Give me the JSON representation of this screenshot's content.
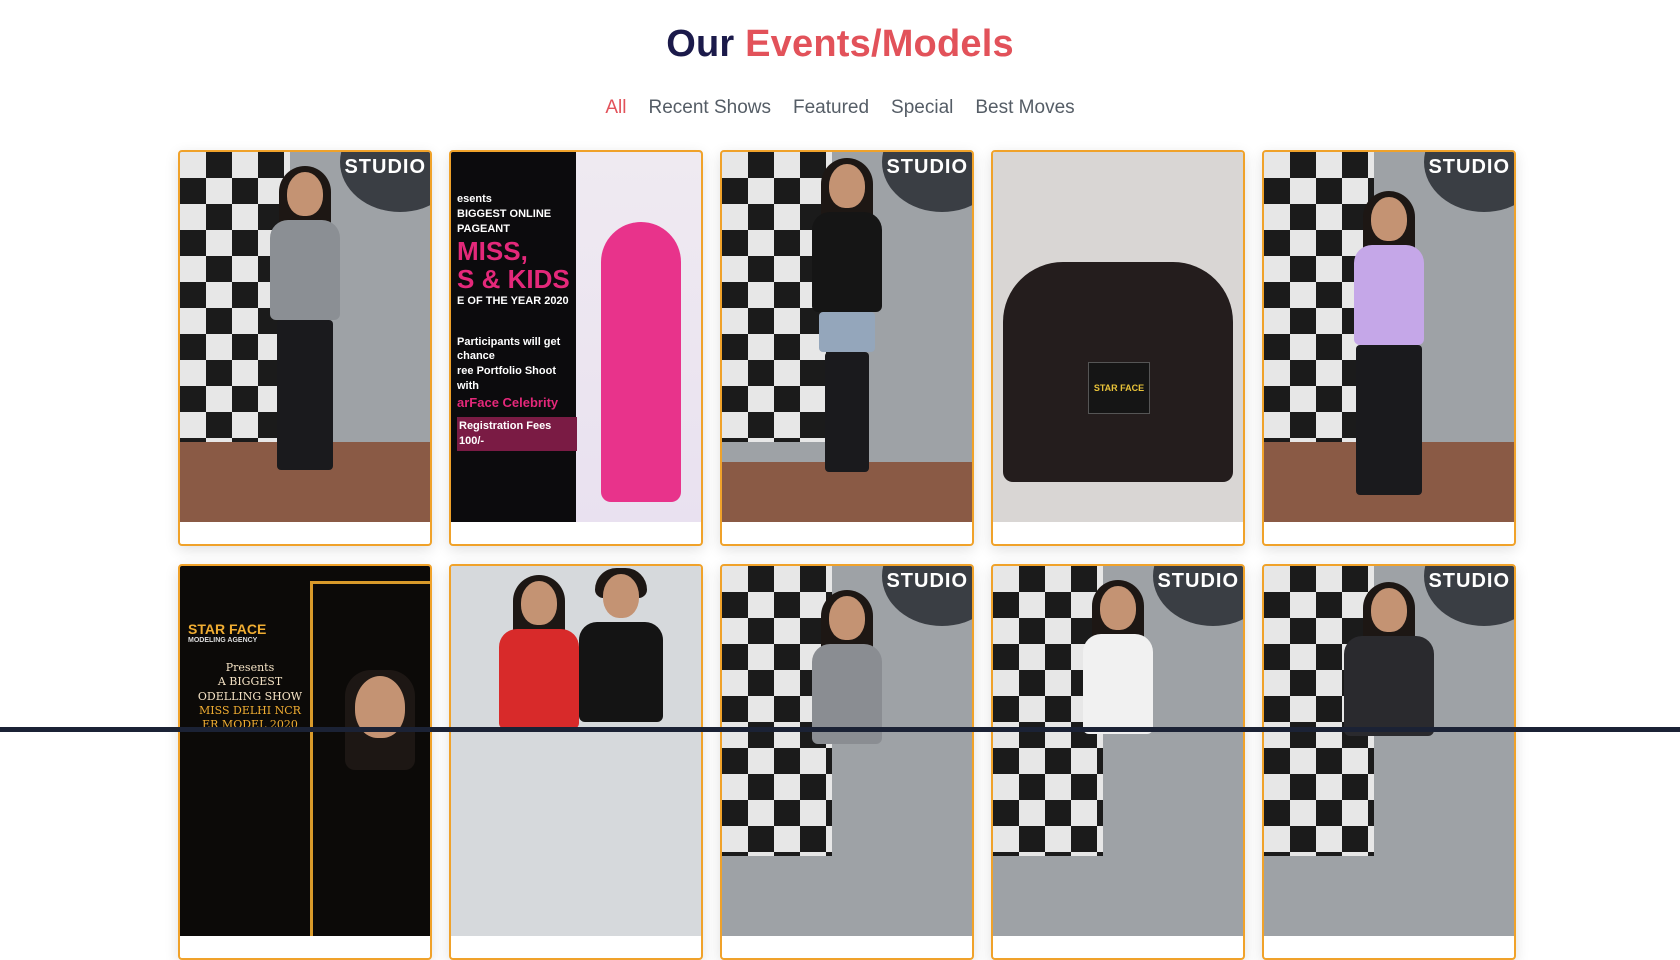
{
  "heading": {
    "dark": "Our",
    "accent": "Events/Models"
  },
  "tabs": [
    {
      "label": "All",
      "active": true
    },
    {
      "label": "Recent Shows",
      "active": false
    },
    {
      "label": "Featured",
      "active": false
    },
    {
      "label": "Special",
      "active": false
    },
    {
      "label": "Best Moves",
      "active": false
    }
  ],
  "posters": {
    "online": {
      "lines": [
        "esents",
        "BIGGEST ONLINE",
        "PAGEANT",
        "MISS,",
        "S & KIDS",
        "E OF THE YEAR 2020",
        "Participants will get chance",
        "ree Portfolio Shoot with",
        "arFace Celebrity",
        "Registration Fees 100/-"
      ]
    },
    "delhi": {
      "logo": "STAR FACE",
      "sub": "MODELING AGENCY",
      "lines": [
        "Presents",
        "A BIGGEST",
        "ODELLING SHOW",
        "MISS DELHI NCR",
        "ER MODEL 2020"
      ]
    },
    "group_sign": "STAR FACE"
  },
  "studio_text": "STUDIO",
  "colors": {
    "accent": "#e2525a",
    "dark": "#1b1a4a",
    "card_border": "#f0a22a"
  }
}
